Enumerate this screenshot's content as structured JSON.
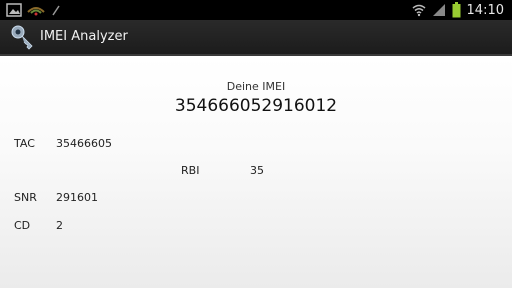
{
  "status_bar": {
    "time": "14:10",
    "notification_icons": [
      "picture-icon",
      "wifi-router-icon",
      "pen-icon"
    ],
    "system_icons": [
      "wifi-icon",
      "signal-icon",
      "battery-icon"
    ]
  },
  "action_bar": {
    "app_icon": "key-icon",
    "title": "IMEI Analyzer"
  },
  "main": {
    "imei_caption": "Deine IMEI",
    "imei_value": "354666052916012",
    "fields": {
      "tac": {
        "label": "TAC",
        "value": "35466605"
      },
      "rbi": {
        "label": "RBI",
        "value": "35"
      },
      "snr": {
        "label": "SNR",
        "value": "291601"
      },
      "cd": {
        "label": "CD",
        "value": "2"
      }
    }
  }
}
